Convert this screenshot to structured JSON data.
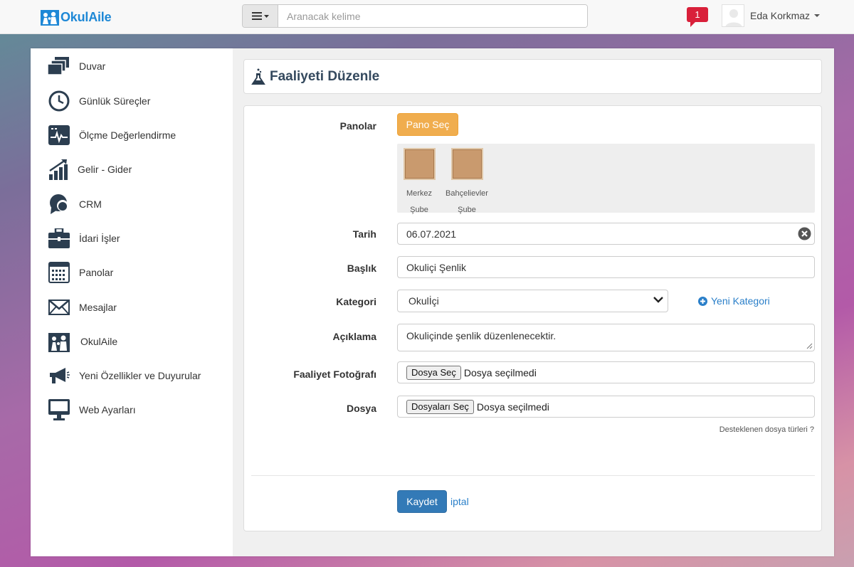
{
  "topbar": {
    "logo_text": "OkulAile",
    "search_placeholder": "Aranacak kelime",
    "notification_count": "1",
    "user_name": "Eda Korkmaz"
  },
  "sidebar": {
    "items": [
      {
        "label": "Duvar",
        "icon": "wall-icon"
      },
      {
        "label": "Günlük Süreçler",
        "icon": "clock-icon"
      },
      {
        "label": "Ölçme Değerlendirme",
        "icon": "monitor-chart-icon"
      },
      {
        "label": "Gelir - Gider",
        "icon": "growth-chart-icon"
      },
      {
        "label": "CRM",
        "icon": "crm-chat-icon"
      },
      {
        "label": "İdari İşler",
        "icon": "briefcase-icon"
      },
      {
        "label": "Panolar",
        "icon": "calendar-board-icon"
      },
      {
        "label": "Mesajlar",
        "icon": "envelope-icon"
      },
      {
        "label": "OkulAile",
        "icon": "family-icon"
      },
      {
        "label": "Yeni Özellikler ve Duyurular",
        "icon": "megaphone-icon"
      },
      {
        "label": "Web Ayarları",
        "icon": "desktop-icon"
      }
    ]
  },
  "page": {
    "title": "Faaliyeti Düzenle",
    "title_icon": "flask-icon"
  },
  "form": {
    "panolar_label": "Panolar",
    "pano_button": "Pano Seç",
    "boards": [
      {
        "name_line1": "Merkez",
        "name_line2": "Şube"
      },
      {
        "name_line1": "Bahçelievler",
        "name_line2": "Şube"
      }
    ],
    "tarih_label": "Tarih",
    "tarih_value": "06.07.2021",
    "baslik_label": "Başlık",
    "baslik_value": "Okuliçi Şenlik",
    "kategori_label": "Kategori",
    "kategori_value": "Okulİçi",
    "new_category_label": "Yeni Kategori",
    "aciklama_label": "Açıklama",
    "aciklama_value": "Okuliçinde şenlik düzenlenecektir.",
    "photo_label": "Faaliyet Fotoğrafı",
    "photo_button": "Dosya Seç",
    "photo_status": "Dosya seçilmedi",
    "file_label": "Dosya",
    "file_button": "Dosyaları Seç",
    "file_status": "Dosya seçilmedi",
    "file_types_hint": "Desteklenen dosya türleri ?",
    "save_button": "Kaydet",
    "cancel_link": "iptal"
  },
  "colors": {
    "accent_blue": "#337ab7",
    "accent_orange": "#f0ad4e",
    "notification_red": "#d9203a",
    "logo_blue": "#1e88d6"
  }
}
